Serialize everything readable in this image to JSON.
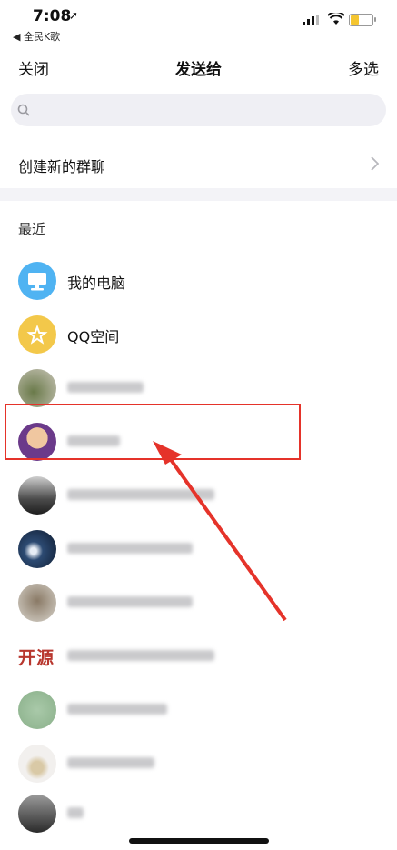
{
  "status_bar": {
    "time": "7:08",
    "location_glyph": "➚",
    "back_app": "◀ 全民K歌"
  },
  "nav": {
    "close_label": "关闭",
    "title": "发送给",
    "multi_select_label": "多选"
  },
  "search": {
    "placeholder": ""
  },
  "group_chat": {
    "label": "创建新的群聊"
  },
  "section_recent": "最近",
  "contacts": [
    {
      "name": "我的电脑",
      "icon": "monitor-icon",
      "color": "#4fb3f2"
    },
    {
      "name": "QQ空间",
      "icon": "star-icon",
      "color": "#f3c84a"
    }
  ],
  "colors": {
    "highlight": "#e5332a",
    "accent_blue": "#4fb3f2",
    "accent_yellow": "#f3c84a"
  }
}
